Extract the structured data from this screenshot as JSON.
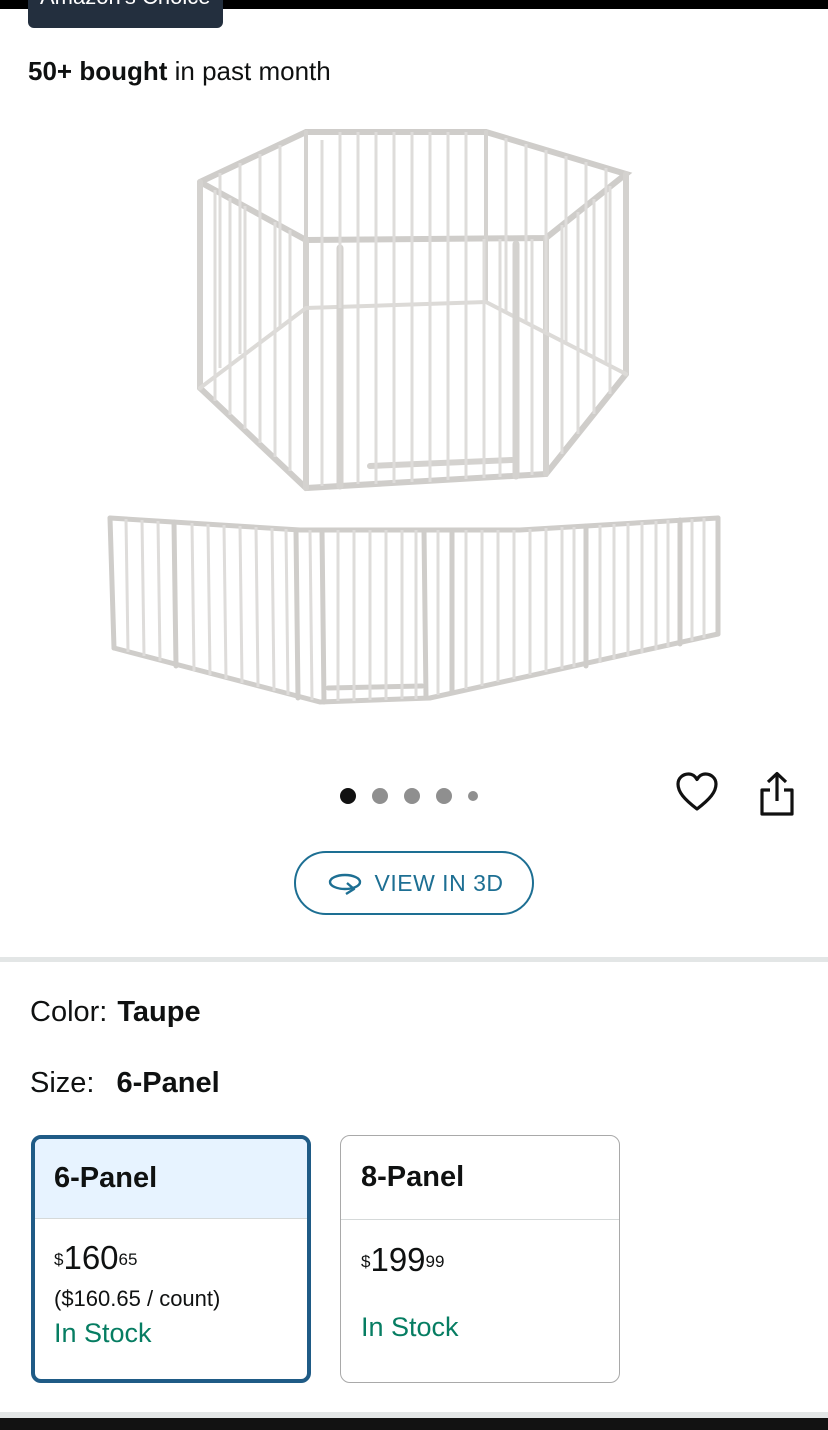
{
  "badge": {
    "text": "Amazon's Choice"
  },
  "bought": {
    "count": "50+ bought",
    "suffix": " in past month"
  },
  "gallery": {
    "image_count": 5,
    "active_index": 0
  },
  "actions": {
    "view3d_label": "VIEW IN 3D"
  },
  "color": {
    "label": "Color:",
    "value": "Taupe"
  },
  "size": {
    "label": "Size:",
    "value": "6-Panel",
    "options": [
      {
        "name": "6-Panel",
        "currency": "$",
        "whole": "160",
        "fraction": "65",
        "unit_price": "($160.65 / count)",
        "stock": "In Stock",
        "selected": true
      },
      {
        "name": "8-Panel",
        "currency": "$",
        "whole": "199",
        "fraction": "99",
        "stock": "In Stock",
        "selected": false
      }
    ]
  },
  "colors": {
    "link": "#1d6f93",
    "in_stock": "#067d62",
    "selected_border": "#1f5b86",
    "selected_bg": "#e7f3ff"
  }
}
